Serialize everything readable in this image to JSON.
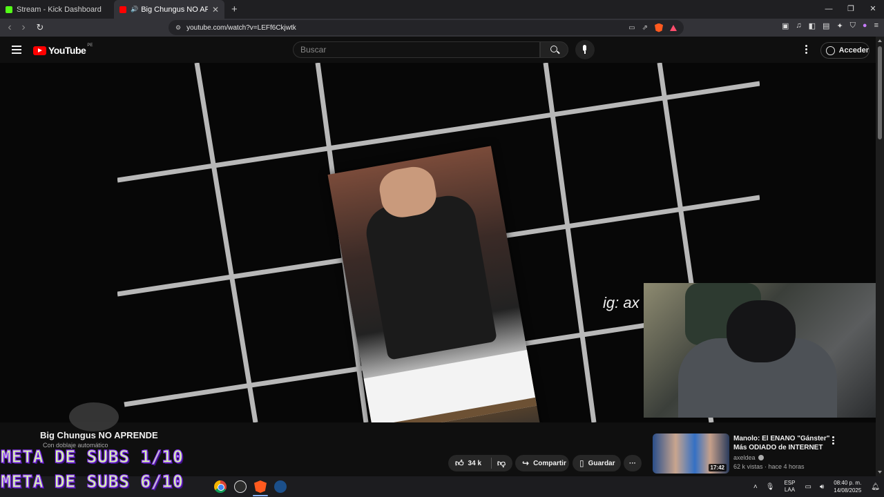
{
  "browser": {
    "tabs": [
      {
        "title": "Stream - Kick Dashboard",
        "favicon_color": "#53fc18"
      },
      {
        "title": "Big Chungus NO APRENDE -",
        "favicon_color": "#ff0000",
        "audio": "🔊"
      }
    ],
    "new_tab": "+",
    "window_controls": [
      "—",
      "❐",
      "✕"
    ],
    "nav": {
      "back": "‹",
      "forward": "›",
      "reload": "↻"
    },
    "url": "youtube.com/watch?v=LEFf6Ckjwtk"
  },
  "youtube": {
    "logo_text": "YouTube",
    "country_code": "PE",
    "search_placeholder": "Buscar",
    "signin_label": "Acceder"
  },
  "video": {
    "watermark": "ig: ax",
    "title": "Big Chungus NO APRENDE",
    "dub_label": "Con doblaje automático"
  },
  "actions": {
    "like_count": "34 k",
    "share_label": "Compartir",
    "save_label": "Guardar",
    "more_label": "···"
  },
  "recommendation": {
    "title": "Manolo: El ENANO \"Gánster\" Más ODIADO de INTERNET",
    "channel": "axeldea",
    "meta": "62 k vistas · hace 4 horas",
    "duration": "17:42"
  },
  "overlay": {
    "goal_1": "META DE SUBS 1/10",
    "goal_2": "META DE SUBS 6/10"
  },
  "taskbar": {
    "lang_top": "ESP",
    "lang_bottom": "LAA",
    "time": "08:40 p. m.",
    "date": "14/08/2025"
  },
  "colors": {
    "yt_red": "#ff0000",
    "overlay_text": "#d8f9a8",
    "overlay_stroke": "#8f39ff"
  }
}
